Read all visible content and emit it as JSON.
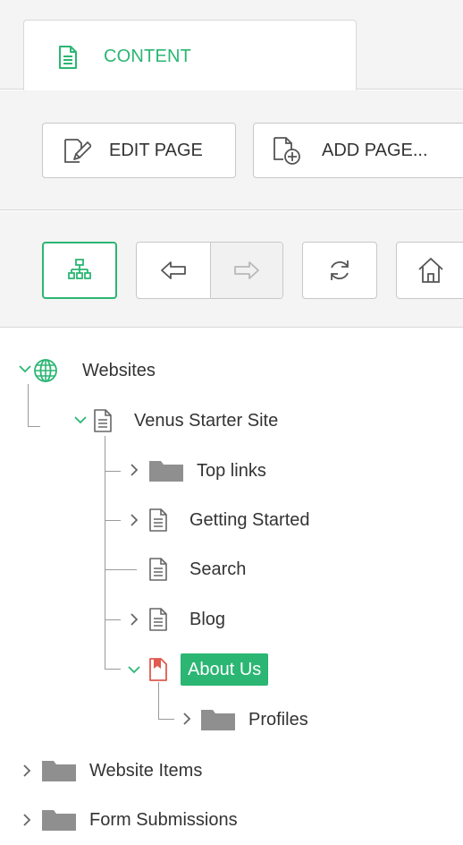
{
  "tabs": [
    {
      "label": "CONTENT",
      "icon": "document-icon",
      "active": true
    }
  ],
  "actions": {
    "edit_page": "EDIT PAGE",
    "add_page": "ADD PAGE..."
  },
  "toolbar": {
    "tree_view": "sitemap-icon",
    "back": "arrow-left-icon",
    "forward": "arrow-right-icon",
    "refresh": "refresh-icon",
    "home": "home-icon"
  },
  "colors": {
    "accent": "#2bb673",
    "folder": "#8f8f8f",
    "bookmark_page": "#e05a4f"
  },
  "tree": {
    "websites": "Websites",
    "site": "Venus Starter Site",
    "top_links": "Top links",
    "getting_started": "Getting Started",
    "search": "Search",
    "blog": "Blog",
    "about_us": "About Us",
    "profiles": "Profiles",
    "website_items": "Website Items",
    "form_submissions": "Form Submissions"
  }
}
